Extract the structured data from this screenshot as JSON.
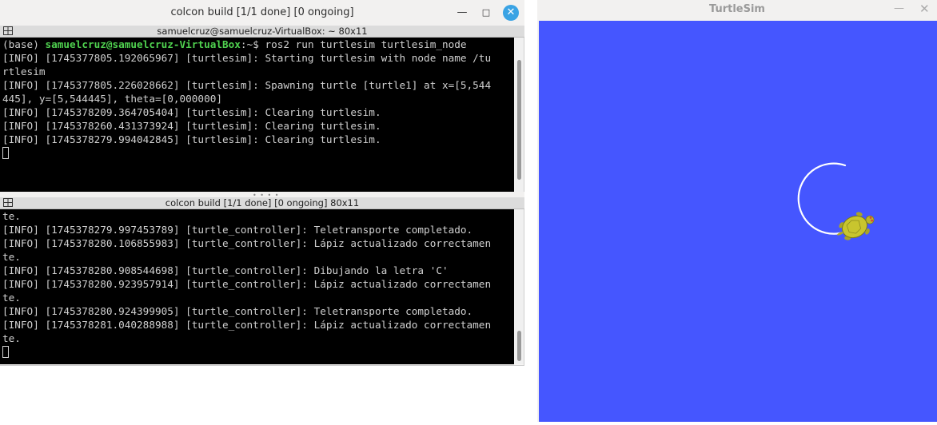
{
  "terminal": {
    "window_title": "colcon build [1/1 done] [0 ongoing]",
    "window_buttons": {
      "minimize": "—",
      "maximize": "□",
      "close": "✕"
    },
    "top_pane": {
      "header": "samuelcruz@samuelcruz-VirtualBox: ~ 80x11",
      "prompt_prefix": "(base) ",
      "prompt_user": "samuelcruz@samuelcruz-VirtualBox",
      "prompt_rest": ":~$ ros2 run turtlesim turtlesim_node",
      "lines": [
        "[INFO] [1745377805.192065967] [turtlesim]: Starting turtlesim with node name /tu",
        "rtlesim",
        "[INFO] [1745377805.226028662] [turtlesim]: Spawning turtle [turtle1] at x=[5,544",
        "445], y=[5,544445], theta=[0,000000]",
        "[INFO] [1745378209.364705404] [turtlesim]: Clearing turtlesim.",
        "[INFO] [1745378260.431373924] [turtlesim]: Clearing turtlesim.",
        "[INFO] [1745378279.994042845] [turtlesim]: Clearing turtlesim."
      ]
    },
    "bottom_pane": {
      "header": "colcon build [1/1 done] [0 ongoing] 80x11",
      "lines": [
        "te.",
        "[INFO] [1745378279.997453789] [turtle_controller]: Teletransporte completado.",
        "[INFO] [1745378280.106855983] [turtle_controller]: Lápiz actualizado correctamen",
        "te.",
        "[INFO] [1745378280.908544698] [turtle_controller]: Dibujando la letra 'C'",
        "[INFO] [1745378280.923957914] [turtle_controller]: Lápiz actualizado correctamen",
        "te.",
        "[INFO] [1745378280.924399905] [turtle_controller]: Teletransporte completado.",
        "[INFO] [1745378281.040288988] [turtle_controller]: Lápiz actualizado correctamen",
        "te."
      ]
    }
  },
  "turtlesim": {
    "window_title": "TurtleSim",
    "window_buttons": {
      "minimize": "—",
      "close": "✕"
    },
    "background_color": "#4556ff",
    "pen_color": "#ffffff",
    "drawn_letter": "C"
  }
}
